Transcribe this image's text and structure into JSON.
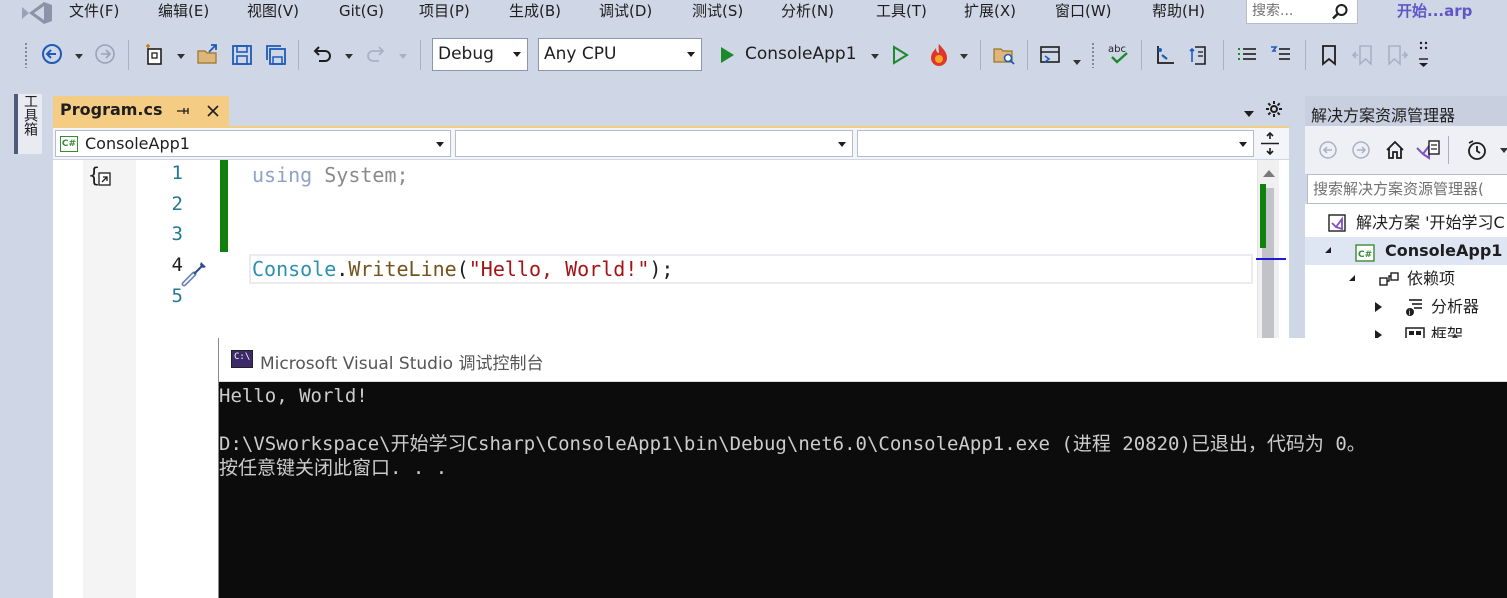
{
  "menubar": {
    "items": [
      "文件(F)",
      "编辑(E)",
      "视图(V)",
      "Git(G)",
      "项目(P)",
      "生成(B)",
      "调试(D)",
      "测试(S)",
      "分析(N)",
      "工具(T)",
      "扩展(X)",
      "窗口(W)",
      "帮助(H)"
    ],
    "search_placeholder": "搜索...",
    "solution_name": "开始...arp"
  },
  "toolbar": {
    "configuration": "Debug",
    "platform": "Any CPU",
    "run_target": "ConsoleApp1"
  },
  "left_strip": {
    "toolbox_label": "工具箱"
  },
  "document": {
    "tab_title": "Program.cs",
    "nav_project": "ConsoleApp1",
    "nav_project_badge": "C#",
    "nav_type": "",
    "nav_member": ""
  },
  "editor": {
    "lines": [
      {
        "number": "1",
        "code": "using System;"
      },
      {
        "number": "2",
        "code": ""
      },
      {
        "number": "3",
        "code": ""
      },
      {
        "number": "4",
        "code": "Console.WriteLine(\"Hello, World!\");"
      },
      {
        "number": "5",
        "code": ""
      }
    ],
    "line1": {
      "keyword": "using",
      "rest": " System;"
    },
    "line4": {
      "class": "Console",
      "dot": ".",
      "method": "WriteLine",
      "open": "(",
      "string": "\"Hello, World!\"",
      "close": ");"
    }
  },
  "solution_explorer": {
    "title": "解决方案资源管理器",
    "search_placeholder": "搜索解决方案资源管理器(",
    "tree": [
      {
        "label": "解决方案 '开始学习C",
        "level": 0,
        "icon": "solution-icon"
      },
      {
        "label": "ConsoleApp1",
        "level": 1,
        "icon": "csharp-project-icon",
        "badge": "C#",
        "selected": true
      },
      {
        "label": "依赖项",
        "level": 2,
        "icon": "dependencies-icon"
      },
      {
        "label": "分析器",
        "level": 3,
        "icon": "analyzer-icon"
      },
      {
        "label": "框架",
        "level": 3,
        "icon": "framework-icon"
      }
    ]
  },
  "console": {
    "icon_text": "C:\\",
    "title": "Microsoft Visual Studio 调试控制台",
    "lines": [
      "Hello, World!",
      "",
      "D:\\VSworkspace\\开始学习Csharp\\ConsoleApp1\\bin\\Debug\\net6.0\\ConsoleApp1.exe (进程 20820)已退出，代码为 0。",
      "按任意键关闭此窗口. . ."
    ]
  },
  "colors": {
    "chrome": "#cfd6e5",
    "active_tab": "#f5cc84",
    "accent": "#5f56c6",
    "change_bar": "#108010",
    "console_bg": "#0c0c0c",
    "console_text": "#cccccc"
  }
}
